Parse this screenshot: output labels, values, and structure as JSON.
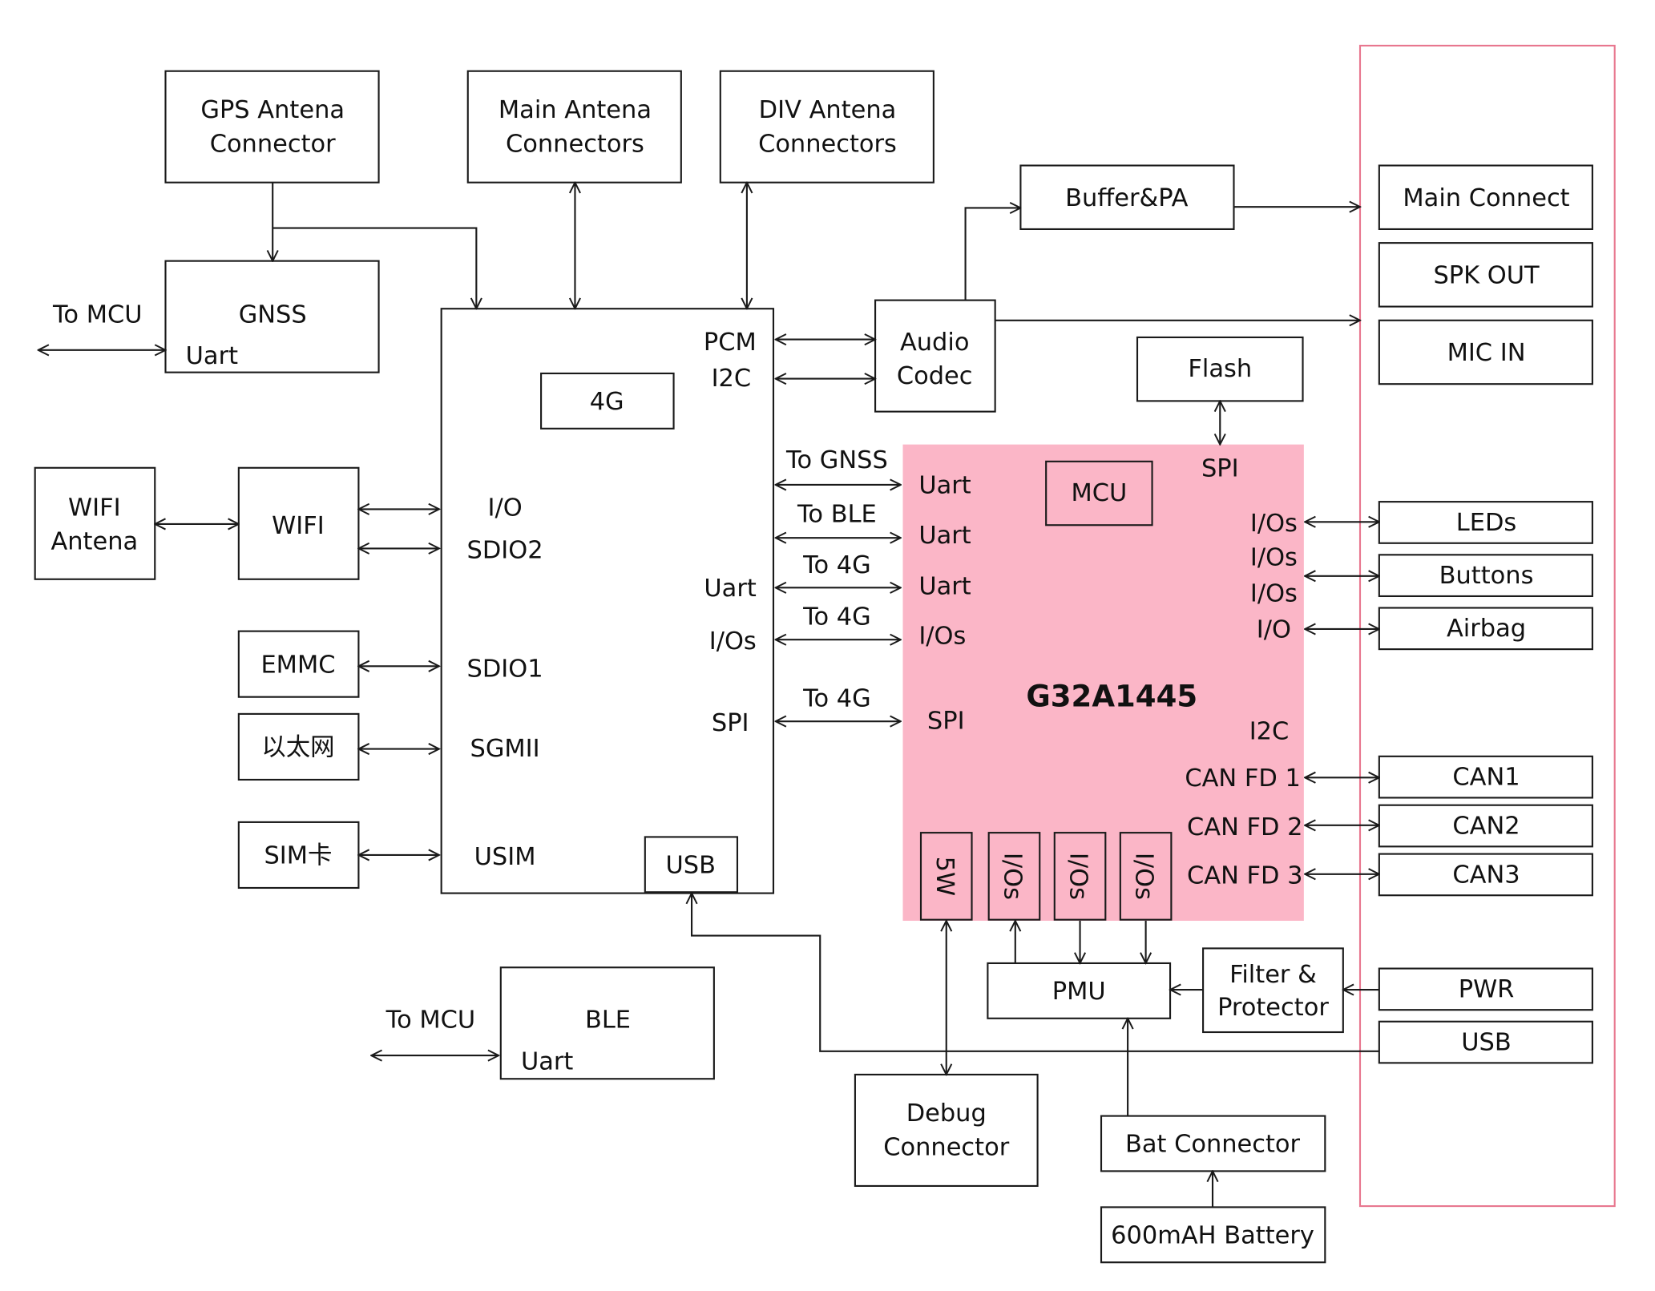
{
  "blocks": {
    "gps_antenna": [
      "GPS Antena",
      "Connector"
    ],
    "main_antenna": [
      "Main Antena",
      "Connectors"
    ],
    "div_antenna": [
      "DIV Antena",
      "Connectors"
    ],
    "buffer_pa": "Buffer&PA",
    "gnss": {
      "title": "GNSS",
      "port": "Uart",
      "link_label": "To MCU"
    },
    "wifi_antenna": [
      "WIFI",
      "Antena"
    ],
    "wifi": "WIFI",
    "emmc": "EMMC",
    "ethernet": "以太网",
    "sim": "SIM卡",
    "ble": {
      "title": "BLE",
      "port": "Uart",
      "link_label": "To MCU"
    },
    "audio_codec": [
      "Audio",
      "Codec"
    ],
    "flash": "Flash",
    "debug_connector": [
      "Debug",
      "Connector"
    ],
    "bat_connector": "Bat Connector",
    "battery": "600mAH Battery",
    "pmu": "PMU",
    "filter": [
      "Filter &",
      "Protector"
    ]
  },
  "module_4g": {
    "chip": "4G",
    "usb": "USB",
    "left_ports": [
      "I/O",
      "SDIO2",
      "SDIO1",
      "SGMII",
      "USIM"
    ],
    "right_ports": [
      "PCM",
      "I2C",
      "Uart",
      "I/Os",
      "SPI"
    ]
  },
  "mcu": {
    "name": "G32A1445",
    "core": "MCU",
    "left_ports": [
      "Uart",
      "Uart",
      "Uart",
      "I/Os",
      "SPI"
    ],
    "top_port": "SPI",
    "right_ports": [
      "I/Os",
      "I/Os",
      "I/Os",
      "I/O",
      "I2C",
      "CAN FD 1",
      "CAN FD 2",
      "CAN FD 3"
    ],
    "bottom_ports": [
      "5W",
      "I/Os",
      "I/Os",
      "I/Os"
    ],
    "color": "#fbb6c7"
  },
  "links": [
    "To GNSS",
    "To BLE",
    "To 4G",
    "To 4G",
    "To 4G"
  ],
  "connector_panel": {
    "items": [
      "Main Connect",
      "SPK OUT",
      "MIC IN",
      "LEDs",
      "Buttons",
      "Airbag",
      "CAN1",
      "CAN2",
      "CAN3",
      "PWR",
      "USB"
    ],
    "frame_color": "#e8778f"
  }
}
